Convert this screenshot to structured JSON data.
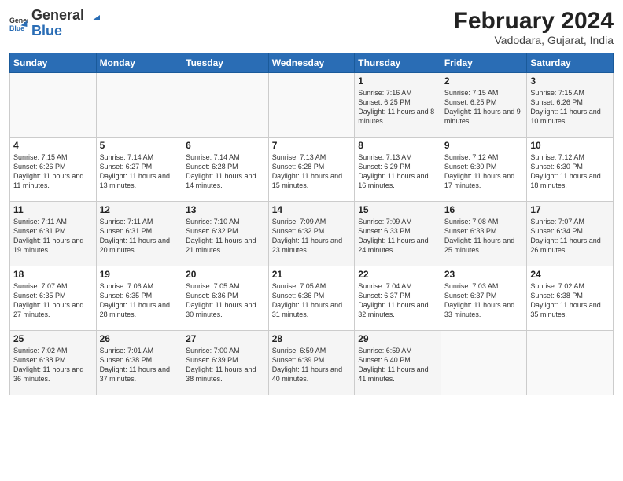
{
  "header": {
    "logo_general": "General",
    "logo_blue": "Blue",
    "month_year": "February 2024",
    "location": "Vadodara, Gujarat, India"
  },
  "days_of_week": [
    "Sunday",
    "Monday",
    "Tuesday",
    "Wednesday",
    "Thursday",
    "Friday",
    "Saturday"
  ],
  "weeks": [
    [
      {
        "day": "",
        "info": ""
      },
      {
        "day": "",
        "info": ""
      },
      {
        "day": "",
        "info": ""
      },
      {
        "day": "",
        "info": ""
      },
      {
        "day": "1",
        "info": "Sunrise: 7:16 AM\nSunset: 6:25 PM\nDaylight: 11 hours and 8 minutes."
      },
      {
        "day": "2",
        "info": "Sunrise: 7:15 AM\nSunset: 6:25 PM\nDaylight: 11 hours and 9 minutes."
      },
      {
        "day": "3",
        "info": "Sunrise: 7:15 AM\nSunset: 6:26 PM\nDaylight: 11 hours and 10 minutes."
      }
    ],
    [
      {
        "day": "4",
        "info": "Sunrise: 7:15 AM\nSunset: 6:26 PM\nDaylight: 11 hours and 11 minutes."
      },
      {
        "day": "5",
        "info": "Sunrise: 7:14 AM\nSunset: 6:27 PM\nDaylight: 11 hours and 13 minutes."
      },
      {
        "day": "6",
        "info": "Sunrise: 7:14 AM\nSunset: 6:28 PM\nDaylight: 11 hours and 14 minutes."
      },
      {
        "day": "7",
        "info": "Sunrise: 7:13 AM\nSunset: 6:28 PM\nDaylight: 11 hours and 15 minutes."
      },
      {
        "day": "8",
        "info": "Sunrise: 7:13 AM\nSunset: 6:29 PM\nDaylight: 11 hours and 16 minutes."
      },
      {
        "day": "9",
        "info": "Sunrise: 7:12 AM\nSunset: 6:30 PM\nDaylight: 11 hours and 17 minutes."
      },
      {
        "day": "10",
        "info": "Sunrise: 7:12 AM\nSunset: 6:30 PM\nDaylight: 11 hours and 18 minutes."
      }
    ],
    [
      {
        "day": "11",
        "info": "Sunrise: 7:11 AM\nSunset: 6:31 PM\nDaylight: 11 hours and 19 minutes."
      },
      {
        "day": "12",
        "info": "Sunrise: 7:11 AM\nSunset: 6:31 PM\nDaylight: 11 hours and 20 minutes."
      },
      {
        "day": "13",
        "info": "Sunrise: 7:10 AM\nSunset: 6:32 PM\nDaylight: 11 hours and 21 minutes."
      },
      {
        "day": "14",
        "info": "Sunrise: 7:09 AM\nSunset: 6:32 PM\nDaylight: 11 hours and 23 minutes."
      },
      {
        "day": "15",
        "info": "Sunrise: 7:09 AM\nSunset: 6:33 PM\nDaylight: 11 hours and 24 minutes."
      },
      {
        "day": "16",
        "info": "Sunrise: 7:08 AM\nSunset: 6:33 PM\nDaylight: 11 hours and 25 minutes."
      },
      {
        "day": "17",
        "info": "Sunrise: 7:07 AM\nSunset: 6:34 PM\nDaylight: 11 hours and 26 minutes."
      }
    ],
    [
      {
        "day": "18",
        "info": "Sunrise: 7:07 AM\nSunset: 6:35 PM\nDaylight: 11 hours and 27 minutes."
      },
      {
        "day": "19",
        "info": "Sunrise: 7:06 AM\nSunset: 6:35 PM\nDaylight: 11 hours and 28 minutes."
      },
      {
        "day": "20",
        "info": "Sunrise: 7:05 AM\nSunset: 6:36 PM\nDaylight: 11 hours and 30 minutes."
      },
      {
        "day": "21",
        "info": "Sunrise: 7:05 AM\nSunset: 6:36 PM\nDaylight: 11 hours and 31 minutes."
      },
      {
        "day": "22",
        "info": "Sunrise: 7:04 AM\nSunset: 6:37 PM\nDaylight: 11 hours and 32 minutes."
      },
      {
        "day": "23",
        "info": "Sunrise: 7:03 AM\nSunset: 6:37 PM\nDaylight: 11 hours and 33 minutes."
      },
      {
        "day": "24",
        "info": "Sunrise: 7:02 AM\nSunset: 6:38 PM\nDaylight: 11 hours and 35 minutes."
      }
    ],
    [
      {
        "day": "25",
        "info": "Sunrise: 7:02 AM\nSunset: 6:38 PM\nDaylight: 11 hours and 36 minutes."
      },
      {
        "day": "26",
        "info": "Sunrise: 7:01 AM\nSunset: 6:38 PM\nDaylight: 11 hours and 37 minutes."
      },
      {
        "day": "27",
        "info": "Sunrise: 7:00 AM\nSunset: 6:39 PM\nDaylight: 11 hours and 38 minutes."
      },
      {
        "day": "28",
        "info": "Sunrise: 6:59 AM\nSunset: 6:39 PM\nDaylight: 11 hours and 40 minutes."
      },
      {
        "day": "29",
        "info": "Sunrise: 6:59 AM\nSunset: 6:40 PM\nDaylight: 11 hours and 41 minutes."
      },
      {
        "day": "",
        "info": ""
      },
      {
        "day": "",
        "info": ""
      }
    ]
  ]
}
